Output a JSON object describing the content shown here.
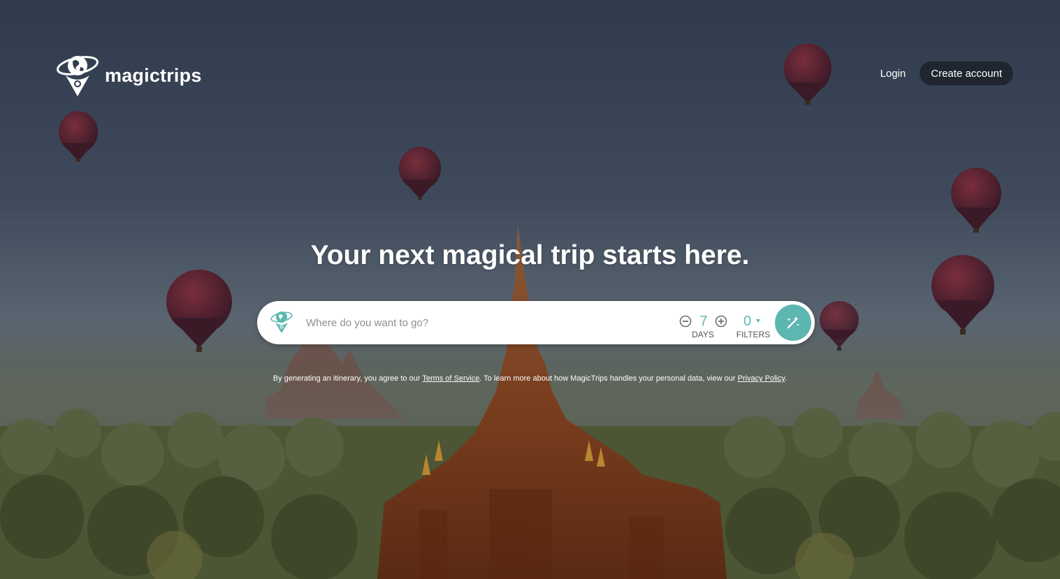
{
  "brand": {
    "name": "magictrips"
  },
  "nav": {
    "login_label": "Login",
    "create_account_label": "Create account"
  },
  "hero": {
    "title": "Your next magical trip starts here."
  },
  "search": {
    "placeholder": "Where do you want to go?",
    "days_value": "7",
    "days_label": "DAYS",
    "filters_value": "0",
    "filters_label": "FILTERS"
  },
  "disclaimer": {
    "text_before": "By generating an itinerary, you agree to our ",
    "terms_link": "Terms of Service",
    "text_middle": ". To learn more about how MagicTrips handles your personal data, view our ",
    "privacy_link": "Privacy Policy",
    "text_after": "."
  },
  "colors": {
    "accent": "#5db7b0",
    "button_dark": "#1f2630",
    "text_white": "#ffffff"
  },
  "icons": {
    "logo": "globe-pin-icon",
    "search_field": "globe-pin-icon",
    "minus": "minus-circle-icon",
    "plus": "plus-circle-icon",
    "filters_caret": "caret-down-icon",
    "generate": "magic-wand-icon"
  }
}
